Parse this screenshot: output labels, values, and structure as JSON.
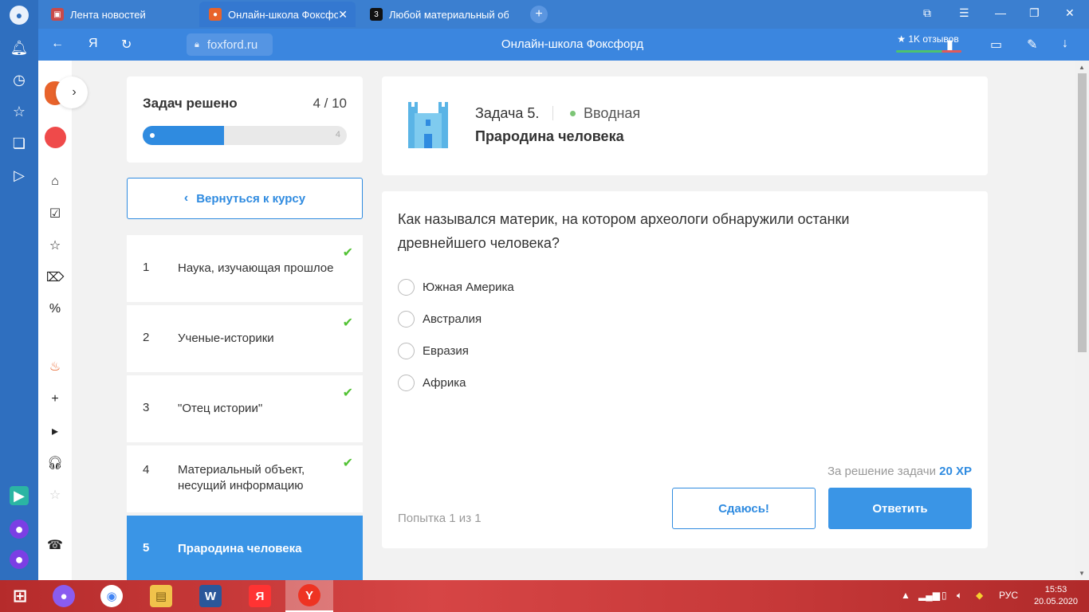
{
  "browser": {
    "tabs": [
      {
        "title": "Лента новостей",
        "active": false
      },
      {
        "title": "Онлайн-школа Фоксфорд",
        "active": true
      },
      {
        "title": "Любой материальный об",
        "active": false
      }
    ],
    "new_tab": "+",
    "url": "foxford.ru",
    "page_title": "Онлайн-школа Фоксфорд",
    "reviews_label": "★ 1K отзывов"
  },
  "progress": {
    "title": "Задач решено",
    "count": "4 / 10",
    "solved": 4,
    "total": 10,
    "end_label": "4"
  },
  "back_button": "Вернуться к курсу",
  "tasks": [
    {
      "num": "1",
      "label": "Наука, изучающая прошлое",
      "done": true
    },
    {
      "num": "2",
      "label": "Ученые-историки",
      "done": true
    },
    {
      "num": "3",
      "label": "\"Отец истории\"",
      "done": true
    },
    {
      "num": "4",
      "label": "Материальный объект, несущий информацию",
      "done": true
    },
    {
      "num": "5",
      "label": "Прародина человека",
      "done": false,
      "active": true
    }
  ],
  "task_header": {
    "number": "Задача 5.",
    "type": "Вводная",
    "name": "Прародина человека"
  },
  "question": {
    "text": "Как назывался материк, на котором археологи обнаружили останки древнейшего человека?",
    "options": [
      "Южная Америка",
      "Австралия",
      "Евразия",
      "Африка"
    ]
  },
  "reward": {
    "prefix": "За решение задачи",
    "value": "20 XP"
  },
  "attempt": "Попытка 1 из 1",
  "buttons": {
    "give_up": "Сдаюсь!",
    "answer": "Ответить"
  },
  "taskbar": {
    "language": "РУС",
    "time": "15:53",
    "date": "20.05.2020"
  },
  "colors": {
    "accent": "#2f8be0",
    "active_task": "#3a95e6",
    "check": "#52c234",
    "browser_blue": "#3b7fd0"
  }
}
